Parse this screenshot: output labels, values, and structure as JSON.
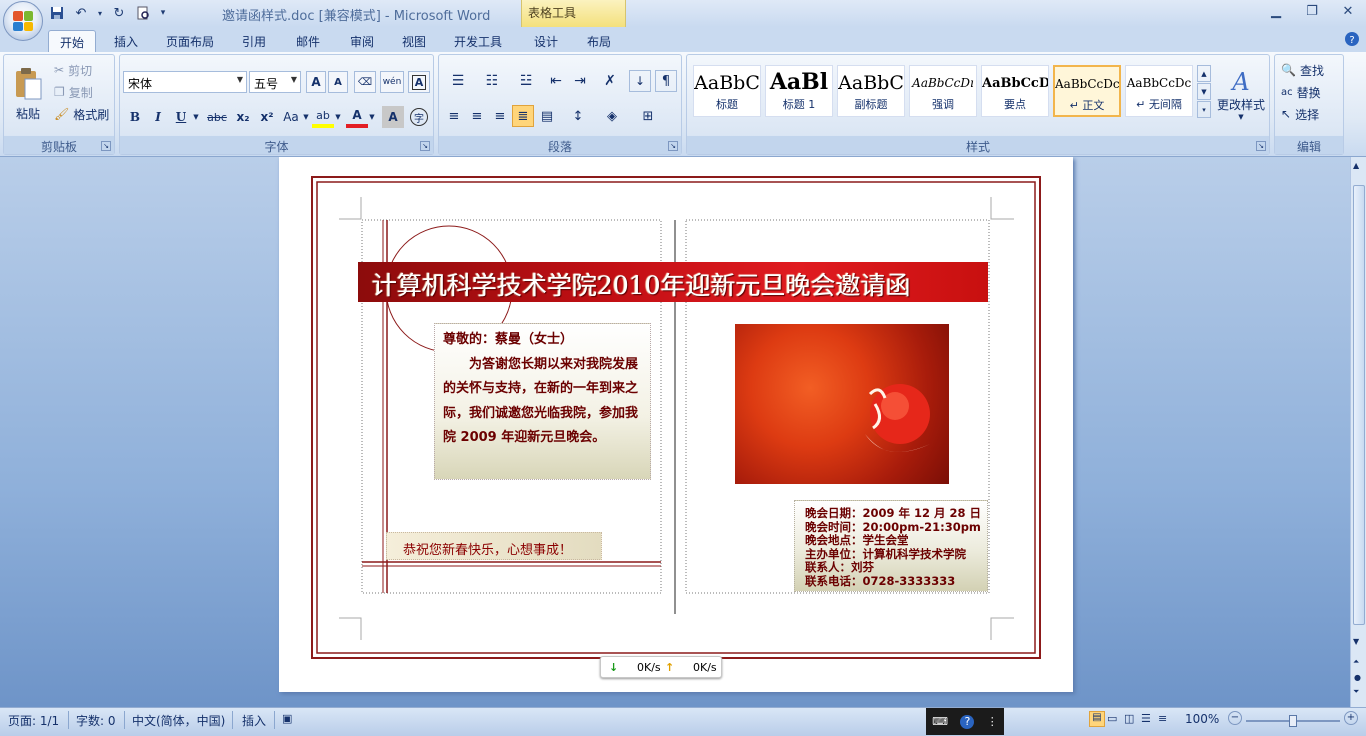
{
  "window": {
    "title": "邀请函样式.doc [兼容模式] - Microsoft Word",
    "contextual_tab_group": "表格工具"
  },
  "tabs": [
    "开始",
    "插入",
    "页面布局",
    "引用",
    "邮件",
    "审阅",
    "视图",
    "开发工具",
    "设计",
    "布局"
  ],
  "ribbon": {
    "clipboard": {
      "label": "剪贴板",
      "paste": "粘贴",
      "cut": "剪切",
      "copy": "复制",
      "format_painter": "格式刷"
    },
    "font": {
      "label": "字体",
      "font_name": "宋体",
      "font_size": "五号",
      "bold": "B",
      "italic": "I",
      "underline": "U",
      "strike": "abc",
      "sub": "x₂",
      "sup": "x²",
      "change_case": "Aa",
      "grow": "A",
      "shrink": "A",
      "phonetic": "wén",
      "highlight": "ab",
      "font_color": "A",
      "char_shading": "A",
      "enclose": "字"
    },
    "paragraph": {
      "label": "段落"
    },
    "styles": {
      "label": "样式",
      "items": [
        {
          "sample": "AaBbC",
          "name": "标题"
        },
        {
          "sample": "AaBl",
          "name": "标题 1"
        },
        {
          "sample": "AaBbC",
          "name": "副标题"
        },
        {
          "sample": "AaBbCcDı",
          "name": "强调"
        },
        {
          "sample": "AaBbCcD",
          "name": "要点"
        },
        {
          "sample": "AaBbCcDc",
          "name": "↵ 正文"
        },
        {
          "sample": "AaBbCcDc",
          "name": "↵ 无间隔"
        }
      ],
      "change_styles": "更改样式"
    },
    "editing": {
      "label": "编辑",
      "find": "查找",
      "replace": "替换",
      "select": "选择"
    }
  },
  "document": {
    "banner": "计算机科学技术学院2010年迎新元旦晚会邀请函",
    "greeting": "尊敬的：蔡曼（女士）",
    "body": "为答谢您长期以来对我院发展的关怀与支持，在新的一年到来之际，我们诚邀您光临我院，参加我院 2009 年迎新元旦晚会。",
    "wish": "恭祝您新春快乐，心想事成！",
    "info_lines": [
      "晚会日期：2009 年 12 月 28 日",
      "晚会时间：20:00pm-21:30pm",
      "晚会地点：学生会堂",
      "主办单位：计算机科学技术学院",
      "联系人：刘芬",
      "联系电话：0728-3333333"
    ]
  },
  "network_popup": {
    "down": "0K/s",
    "up": "0K/s"
  },
  "statusbar": {
    "page": "页面: 1/1",
    "words": "字数: 0",
    "language": "中文(简体，中国)",
    "mode": "插入",
    "zoom": "100%"
  }
}
